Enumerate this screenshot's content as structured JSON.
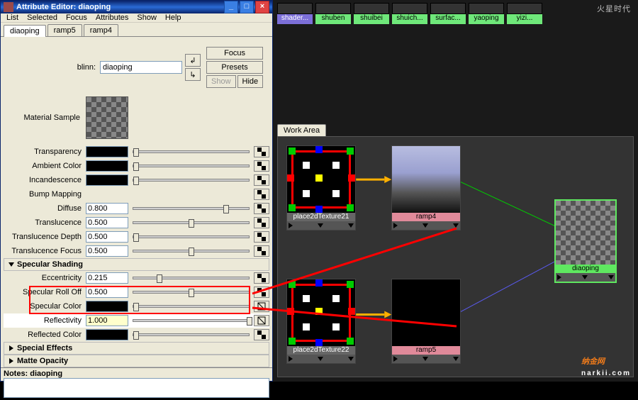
{
  "window": {
    "title": "Attribute Editor: diaoping"
  },
  "menu": [
    "List",
    "Selected",
    "Focus",
    "Attributes",
    "Show",
    "Help"
  ],
  "tabs": [
    "diaoping",
    "ramp5",
    "ramp4"
  ],
  "node_type": "blinn:",
  "node_name": "diaoping",
  "buttons": {
    "focus": "Focus",
    "presets": "Presets",
    "show": "Show",
    "hide": "Hide"
  },
  "sample_label": "Material Sample",
  "attrs": {
    "transparency": "Transparency",
    "ambient": "Ambient Color",
    "incandescence": "Incandescence",
    "bump": "Bump Mapping",
    "diffuse_l": "Diffuse",
    "diffuse_v": "0.800",
    "transl_l": "Translucence",
    "transl_v": "0.500",
    "transld_l": "Translucence Depth",
    "transld_v": "0.500",
    "translf_l": "Translucence Focus",
    "translf_v": "0.500"
  },
  "spec_section": "Specular Shading",
  "spec": {
    "ecc_l": "Eccentricity",
    "ecc_v": "0.215",
    "roll_l": "Specular Roll Off",
    "roll_v": "0.500",
    "color_l": "Specular Color",
    "refl_l": "Reflectivity",
    "refl_v": "1.000",
    "reflc_l": "Reflected Color"
  },
  "sections": {
    "sfx": "Special Effects",
    "matte": "Matte Opacity"
  },
  "notes_label": "Notes: diaoping",
  "shelf": [
    {
      "name": "shader...",
      "sel": true
    },
    {
      "name": "shuben"
    },
    {
      "name": "shuibei"
    },
    {
      "name": "shuich..."
    },
    {
      "name": "surfac..."
    },
    {
      "name": "yaoping"
    },
    {
      "name": "yizi..."
    }
  ],
  "work_area": "Work Area",
  "nodes": {
    "p2d1": "place2dTexture21",
    "p2d2": "place2dTexture22",
    "ramp4": "ramp4",
    "ramp5": "ramp5",
    "out": "diaoping"
  },
  "logos": {
    "top": "火星时代",
    "bottom": "纳金网",
    "bottom_en": "narkii.com"
  }
}
